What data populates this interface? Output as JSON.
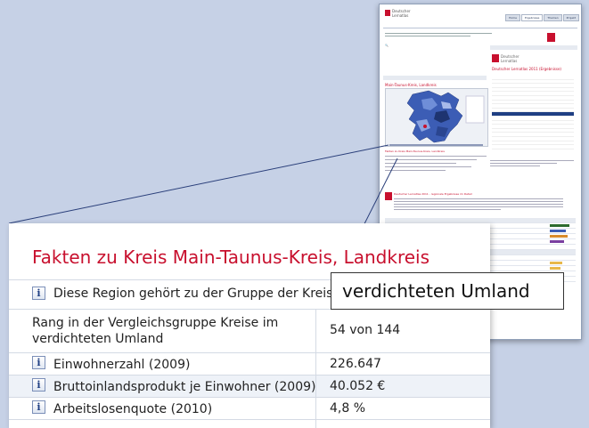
{
  "mini": {
    "logo_line1": "Deutscher",
    "logo_line2": "Lernatlas",
    "nav": [
      "Home",
      "Ergebnisse",
      "Themen",
      "Projekt"
    ],
    "region_title": "Main-Taunus-Kreis, Landkreis",
    "results_title": "Deutscher Lernatlas 2011 (Ergebnisse)",
    "facts_title": "Fakten zu Kreis Main-Taunus-Kreis, Landkreis",
    "section2_title": "Deutscher Lernatlas 2011 - regionale Ergebnisse im Detail"
  },
  "facts": {
    "title": "Fakten zu Kreis Main-Taunus-Kreis, Landkreis",
    "group_text": "Diese Region gehört zu der Gruppe der Kreise im",
    "rows": [
      {
        "label": "Rang in der Vergleichsgruppe Kreise im verdichteten Umland",
        "value": "54 von 144"
      },
      {
        "label": "Einwohnerzahl (2009)",
        "value": "226.647"
      },
      {
        "label": "Bruttoinlandsprodukt je Einwohner (2009)",
        "value": "40.052 €"
      },
      {
        "label": "Arbeitslosenquote (2010)",
        "value": "4,8 %"
      }
    ],
    "info_icon_glyph": "i"
  },
  "tooltip": {
    "text": "verdichteten Umland"
  },
  "colors": {
    "accent": "#c8102e",
    "navy": "#1f3f83",
    "background": "#c6d1e6"
  }
}
